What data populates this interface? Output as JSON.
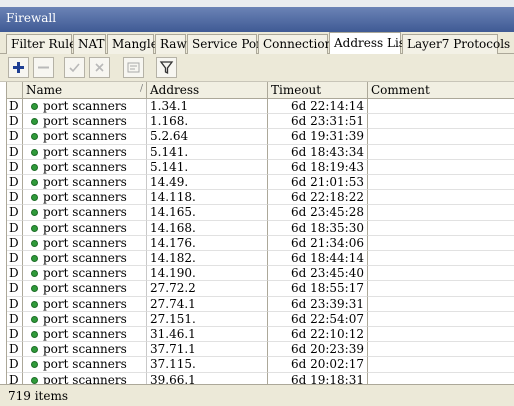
{
  "window": {
    "title": "Firewall"
  },
  "tabs": [
    {
      "label": "Filter Rules"
    },
    {
      "label": "NAT"
    },
    {
      "label": "Mangle"
    },
    {
      "label": "Raw"
    },
    {
      "label": "Service Ports"
    },
    {
      "label": "Connections"
    },
    {
      "label": "Address Lists",
      "active": true
    },
    {
      "label": "Layer7 Protocols"
    }
  ],
  "toolbar": {
    "icons": [
      "plus-icon",
      "minus-icon",
      "check-icon",
      "x-icon",
      "comment-icon",
      "filter-icon"
    ]
  },
  "columns": {
    "flag": "",
    "name": "Name",
    "address": "Address",
    "timeout": "Timeout",
    "comment": "Comment"
  },
  "rows": [
    {
      "flag": "D",
      "name": "port scanners",
      "address": "1.34.1",
      "timeout": "6d 22:14:14",
      "comment": ""
    },
    {
      "flag": "D",
      "name": "port scanners",
      "address": "1.168.",
      "timeout": "6d 23:31:51",
      "comment": ""
    },
    {
      "flag": "D",
      "name": "port scanners",
      "address": "5.2.64",
      "timeout": "6d 19:31:39",
      "comment": ""
    },
    {
      "flag": "D",
      "name": "port scanners",
      "address": "5.141.",
      "timeout": "6d 18:43:34",
      "comment": ""
    },
    {
      "flag": "D",
      "name": "port scanners",
      "address": "5.141.",
      "timeout": "6d 18:19:43",
      "comment": ""
    },
    {
      "flag": "D",
      "name": "port scanners",
      "address": "14.49.",
      "timeout": "6d 21:01:53",
      "comment": ""
    },
    {
      "flag": "D",
      "name": "port scanners",
      "address": "14.118.",
      "timeout": "6d 22:18:22",
      "comment": ""
    },
    {
      "flag": "D",
      "name": "port scanners",
      "address": "14.165.",
      "timeout": "6d 23:45:28",
      "comment": ""
    },
    {
      "flag": "D",
      "name": "port scanners",
      "address": "14.168.",
      "timeout": "6d 18:35:30",
      "comment": ""
    },
    {
      "flag": "D",
      "name": "port scanners",
      "address": "14.176.",
      "timeout": "6d 21:34:06",
      "comment": ""
    },
    {
      "flag": "D",
      "name": "port scanners",
      "address": "14.182.",
      "timeout": "6d 18:44:14",
      "comment": ""
    },
    {
      "flag": "D",
      "name": "port scanners",
      "address": "14.190.",
      "timeout": "6d 23:45:40",
      "comment": ""
    },
    {
      "flag": "D",
      "name": "port scanners",
      "address": "27.72.2",
      "timeout": "6d 18:55:17",
      "comment": ""
    },
    {
      "flag": "D",
      "name": "port scanners",
      "address": "27.74.1",
      "timeout": "6d 23:39:31",
      "comment": ""
    },
    {
      "flag": "D",
      "name": "port scanners",
      "address": "27.151.",
      "timeout": "6d 22:54:07",
      "comment": ""
    },
    {
      "flag": "D",
      "name": "port scanners",
      "address": "31.46.1",
      "timeout": "6d 22:10:12",
      "comment": ""
    },
    {
      "flag": "D",
      "name": "port scanners",
      "address": "37.71.1",
      "timeout": "6d 20:23:39",
      "comment": ""
    },
    {
      "flag": "D",
      "name": "port scanners",
      "address": "37.115.",
      "timeout": "6d 20:02:17",
      "comment": ""
    },
    {
      "flag": "D",
      "name": "port scanners",
      "address": "39.66.1",
      "timeout": "6d 19:18:31",
      "comment": ""
    }
  ],
  "status": {
    "items": "719 items"
  }
}
